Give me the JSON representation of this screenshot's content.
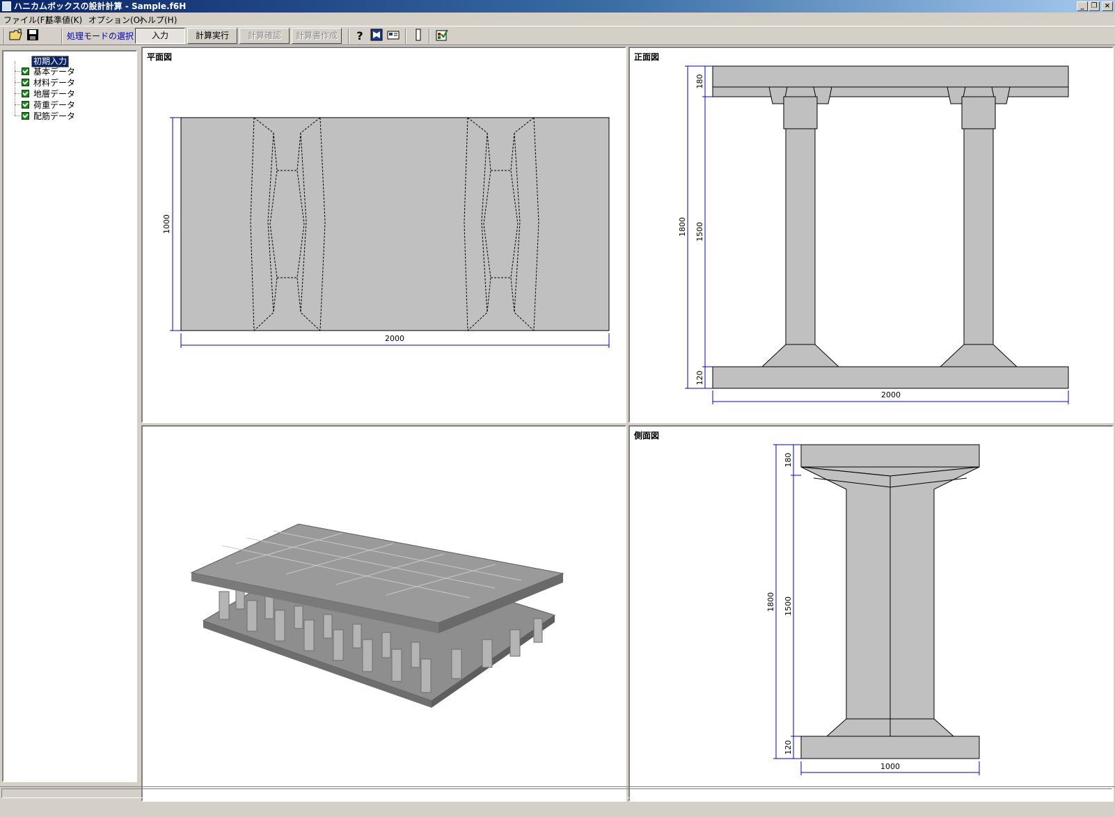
{
  "window": {
    "title": "ハニカムボックスの設計計算 - Sample.f6H"
  },
  "menu": [
    {
      "label": "ファイル(F)"
    },
    {
      "label": "基準値(K)"
    },
    {
      "label": "オプション(O)"
    },
    {
      "label": "ヘルプ(H)"
    }
  ],
  "toolbar": {
    "mode_label": "処理モードの選択",
    "buttons": {
      "input": "入力",
      "calc_run": "計算実行",
      "calc_check": "計算確認",
      "report": "計算書作成"
    }
  },
  "tree": {
    "root": "初期入力",
    "items": [
      {
        "label": "基本データ"
      },
      {
        "label": "材料データ"
      },
      {
        "label": "地層データ"
      },
      {
        "label": "荷重データ"
      },
      {
        "label": "配筋データ"
      }
    ]
  },
  "plan_view": {
    "title": "平面図",
    "dim_width": "2000",
    "dim_height": "1000"
  },
  "front_view": {
    "title": "正面図",
    "dim_width": "2000",
    "dim_total": "1800",
    "dim_top": "180",
    "dim_mid": "1500",
    "dim_bottom": "120"
  },
  "side_view": {
    "title": "側面図",
    "dim_width": "1000",
    "dim_total": "1800",
    "dim_top": "180",
    "dim_mid": "1500",
    "dim_bottom": "120"
  },
  "colors": {
    "dimension": "#0000c8",
    "member_fill": "#c0c0c0"
  }
}
